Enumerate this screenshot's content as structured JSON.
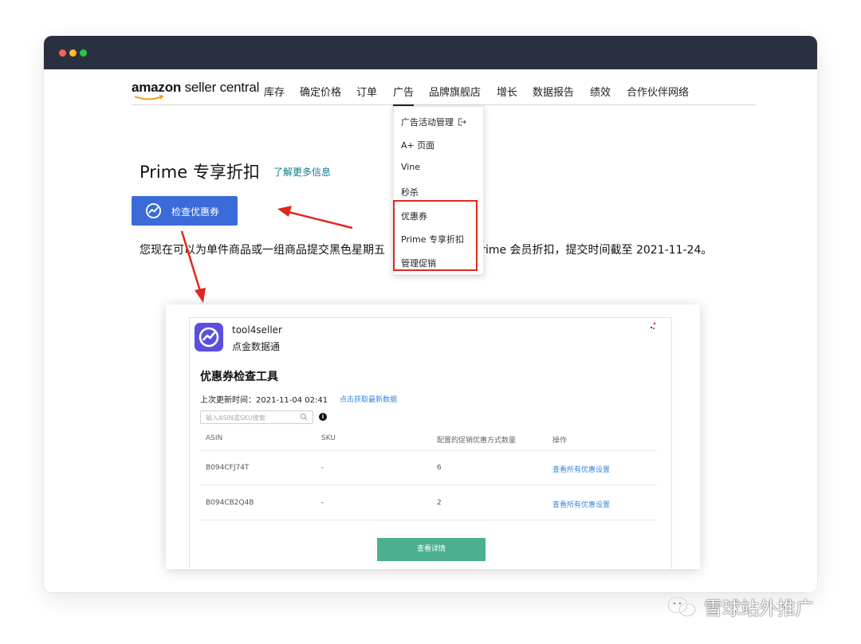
{
  "nav": {
    "logo_bold": "amazon",
    "logo_rest": " seller central",
    "items": [
      "库存",
      "确定价格",
      "订单",
      "广告",
      "品牌旗舰店",
      "增长",
      "数据报告",
      "绩效",
      "合作伙伴网络"
    ],
    "active_index": 3
  },
  "dropdown": {
    "items": [
      "广告活动管理",
      "A+ 页面",
      "Vine",
      "秒杀",
      "优惠券",
      "Prime 专享折扣",
      "管理促销"
    ],
    "external_icon": "external-link-icon",
    "highlight_color": "#e0281e"
  },
  "page": {
    "title": "Prime 专享折扣",
    "learn_more": "了解更多信息",
    "check_button": "检查优惠券",
    "description": "您现在可以为单件商品或一组商品提交黑色星期五",
    "description_tail": "Prime 会员折扣，提交时间截至 2021-11-24。"
  },
  "panel": {
    "brand_name": "tool4seller",
    "brand_sub": "点金数据通",
    "tool_title": "优惠券检查工具",
    "update_time": "上次更新时间：2021-11-04 02:41",
    "refresh_link": "点击获取最新数据",
    "search_placeholder": "输入ASIN或SKU搜索",
    "headers": [
      "ASIN",
      "SKU",
      "配置的促销优惠方式数量",
      "操作"
    ],
    "rows": [
      {
        "asin": "B094CFJ74T",
        "sku": "-",
        "count": "6",
        "action": "查看所有优惠设置"
      },
      {
        "asin": "B094CB2Q4B",
        "sku": "-",
        "count": "2",
        "action": "查看所有优惠设置"
      }
    ],
    "detail_button": "查看详情"
  },
  "watermark": {
    "text": "雪球站外推广",
    "icon": "wechat-icon"
  },
  "colors": {
    "titlebar": "#2b3040",
    "primary_button": "#3a6bd9",
    "arrow": "#e0281e",
    "detail_button": "#4caf92",
    "link": "#0a7e8c"
  }
}
